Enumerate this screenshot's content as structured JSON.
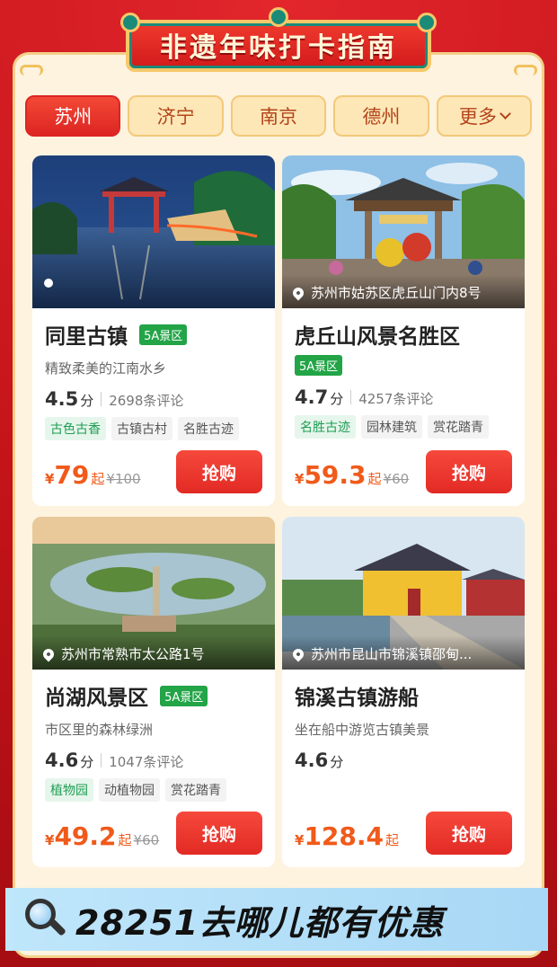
{
  "header": {
    "title": "非遗年味打卡指南"
  },
  "tabs": [
    {
      "label": "苏州",
      "active": true
    },
    {
      "label": "济宁",
      "active": false
    },
    {
      "label": "南京",
      "active": false
    },
    {
      "label": "德州",
      "active": false
    },
    {
      "label": "更多",
      "active": false,
      "icon": "chevron-down-icon"
    }
  ],
  "cards": [
    {
      "name": "同里古镇",
      "badge": "5A景区",
      "address": "",
      "subtitle": "精致柔美的江南水乡",
      "score": "4.5",
      "score_unit": "分",
      "reviews": "2698条评论",
      "tags": [
        "古色古香",
        "古镇古村",
        "名胜古迹"
      ],
      "currency": "¥",
      "price": "79",
      "price_suffix": "起",
      "original_price": "¥100",
      "buy_label": "抢购"
    },
    {
      "name": "虎丘山风景名胜区",
      "badge": "5A景区",
      "address": "苏州市姑苏区虎丘山门内8号",
      "subtitle": "",
      "score": "4.7",
      "score_unit": "分",
      "reviews": "4257条评论",
      "tags": [
        "名胜古迹",
        "园林建筑",
        "赏花踏青"
      ],
      "currency": "¥",
      "price": "59.3",
      "price_suffix": "起",
      "original_price": "¥60",
      "buy_label": "抢购"
    },
    {
      "name": "尚湖风景区",
      "badge": "5A景区",
      "address": "苏州市常熟市太公路1号",
      "subtitle": "市区里的森林绿洲",
      "score": "4.6",
      "score_unit": "分",
      "reviews": "1047条评论",
      "tags": [
        "植物园",
        "动植物园",
        "赏花踏青"
      ],
      "currency": "¥",
      "price": "49.2",
      "price_suffix": "起",
      "original_price": "¥60",
      "buy_label": "抢购"
    },
    {
      "name": "锦溪古镇游船",
      "badge": "",
      "address": "苏州市昆山市锦溪镇邵甸...",
      "subtitle": "坐在船中游览古镇美景",
      "score": "4.6",
      "score_unit": "分",
      "reviews": "",
      "tags": [],
      "currency": "¥",
      "price": "128.4",
      "price_suffix": "起",
      "original_price": "",
      "buy_label": "抢购"
    }
  ],
  "footer": {
    "slogan": "28251去哪儿都有优惠",
    "icon": "magnifier-icon"
  },
  "colors": {
    "background_red": "#c8161e",
    "panel_cream": "#fdf3df",
    "accent_orange": "#f05a1a",
    "buy_red": "#e22a24",
    "badge_green": "#22a447",
    "footer_blue": "#a8d8f5"
  }
}
